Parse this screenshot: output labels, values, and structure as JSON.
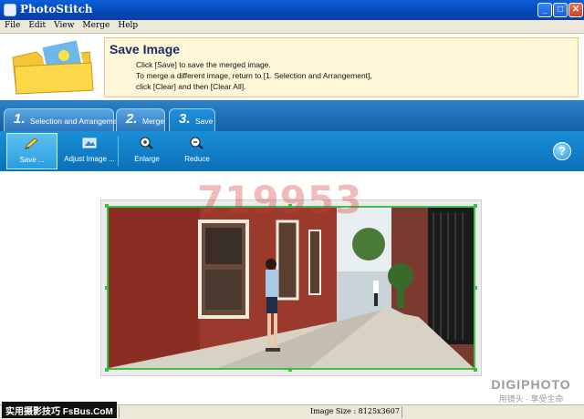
{
  "window": {
    "title": "PhotoStitch",
    "min": "_",
    "max": "□",
    "close": "✕"
  },
  "menu": [
    "File",
    "Edit",
    "View",
    "Merge",
    "Help"
  ],
  "header": {
    "title": "Save Image",
    "lines": [
      "Click [Save] to save the merged image.",
      "To merge a different image, return to [1. Selection and Arrangement],",
      "click [Clear] and then [Clear All]."
    ]
  },
  "tabs": [
    {
      "num": "1.",
      "label": "Selection and Arrangement"
    },
    {
      "num": "2.",
      "label": "Merge"
    },
    {
      "num": "3.",
      "label": "Save"
    }
  ],
  "toolbar": {
    "save": "Save ...",
    "adjust": "Adjust Image ...",
    "enlarge": "Enlarge",
    "reduce": "Reduce",
    "help": "?"
  },
  "watermark": "719953",
  "status": {
    "image_size": "Image Size : 8125x3607"
  },
  "site_watermark": {
    "left": "实用摄影技巧 FsBus.CoM",
    "right_big": "DIGIPHOTO",
    "right_small": "用镜头 · 享受生命"
  }
}
